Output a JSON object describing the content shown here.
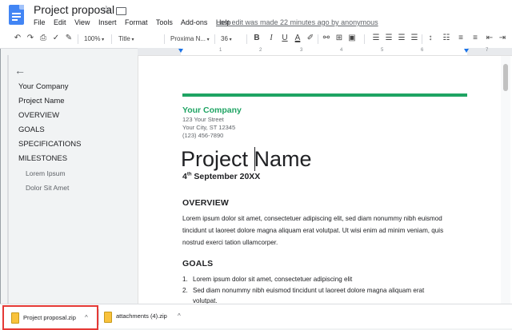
{
  "app": {
    "title": "Project proposal",
    "menus": [
      "File",
      "Edit",
      "View",
      "Insert",
      "Format",
      "Tools",
      "Add-ons",
      "Help"
    ],
    "last_edit": "Last edit was made 22 minutes ago by anonymous"
  },
  "toolbar": {
    "zoom": "100%",
    "style": "Title",
    "font": "Proxima N...",
    "size": "36",
    "bold": "B",
    "italic": "I",
    "underline": "U",
    "text_color": "A"
  },
  "ruler": {
    "numbers": [
      "1",
      "2",
      "3",
      "4",
      "5",
      "6",
      "7"
    ]
  },
  "outline": {
    "items": [
      {
        "label": "Your Company",
        "level": 1
      },
      {
        "label": "Project Name",
        "level": 1
      },
      {
        "label": "OVERVIEW",
        "level": 1
      },
      {
        "label": "GOALS",
        "level": 1
      },
      {
        "label": "SPECIFICATIONS",
        "level": 1
      },
      {
        "label": "MILESTONES",
        "level": 1
      },
      {
        "label": "Lorem Ipsum",
        "level": 2
      },
      {
        "label": "Dolor Sit Amet",
        "level": 2
      }
    ]
  },
  "document": {
    "company": "Your Company",
    "address": [
      "123 Your Street",
      "Your City, ST 12345",
      "(123) 456-7890"
    ],
    "project_name": "Project Name",
    "date_day": "4",
    "date_suffix": "th",
    "date_rest": " September 20XX",
    "overview_heading": "OVERVIEW",
    "overview_lines": [
      "Lorem ipsum dolor sit amet, consectetuer adipiscing elit, sed diam nonummy nibh euismod",
      "tincidunt ut laoreet dolore magna aliquam erat volutpat. Ut wisi enim ad minim veniam, quis",
      "nostrud exerci tation ullamcorper."
    ],
    "goals_heading": "GOALS",
    "goals": [
      {
        "num": "1.",
        "lines": [
          "Lorem ipsum dolor sit amet, consectetuer adipiscing elit"
        ]
      },
      {
        "num": "2.",
        "lines": [
          "Sed diam nonummy nibh euismod tincidunt ut laoreet dolore magna aliquam erat",
          "volutpat."
        ]
      }
    ]
  },
  "downloads": [
    {
      "filename": "Project proposal.zip",
      "highlighted": true
    },
    {
      "filename": "attachments (4).zip",
      "highlighted": false
    }
  ],
  "colors": {
    "accent": "#1fa463",
    "docs_blue": "#4285f4",
    "highlight_border": "#e53935"
  }
}
